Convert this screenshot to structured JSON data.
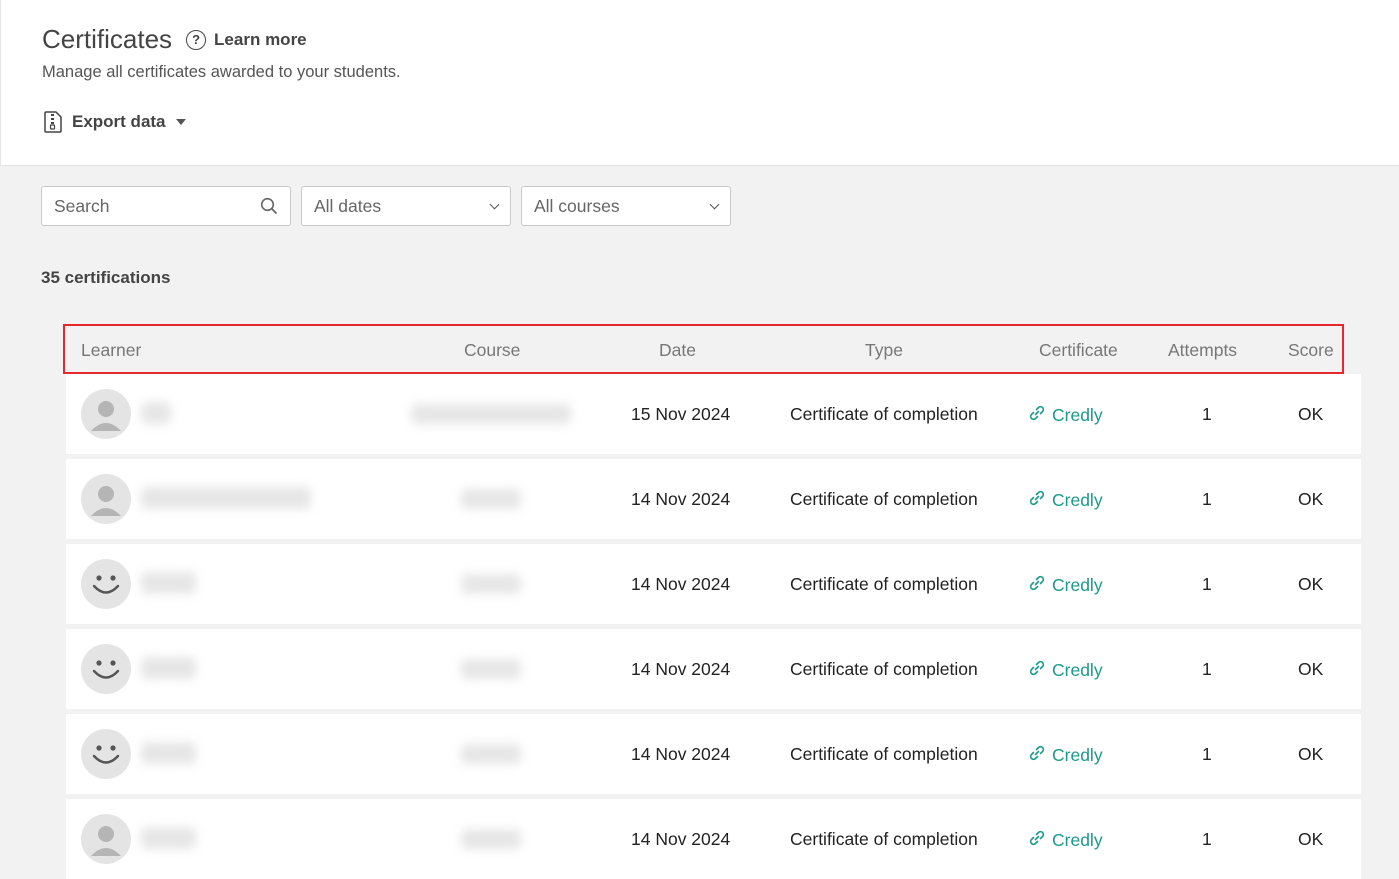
{
  "header": {
    "title": "Certificates",
    "help_label": "Learn more",
    "subtitle": "Manage all certificates awarded to your students.",
    "export_label": "Export data"
  },
  "filters": {
    "search_placeholder": "Search",
    "dates_value": "All dates",
    "courses_value": "All courses"
  },
  "count_label": "35 certifications",
  "columns": {
    "learner": "Learner",
    "course": "Course",
    "date": "Date",
    "type": "Type",
    "certificate": "Certificate",
    "attempts": "Attempts",
    "score": "Score"
  },
  "rows": [
    {
      "avatar": "person-avatar-icon",
      "date": "15 Nov 2024",
      "type": "Certificate of completion",
      "certificate": "Credly",
      "attempts": "1",
      "score": "OK"
    },
    {
      "avatar": "person-avatar-icon",
      "date": "14 Nov 2024",
      "type": "Certificate of completion",
      "certificate": "Credly",
      "attempts": "1",
      "score": "OK"
    },
    {
      "avatar": "smiley-avatar-icon",
      "date": "14 Nov 2024",
      "type": "Certificate of completion",
      "certificate": "Credly",
      "attempts": "1",
      "score": "OK"
    },
    {
      "avatar": "smiley-avatar-icon",
      "date": "14 Nov 2024",
      "type": "Certificate of completion",
      "certificate": "Credly",
      "attempts": "1",
      "score": "OK"
    },
    {
      "avatar": "smiley-avatar-icon",
      "date": "14 Nov 2024",
      "type": "Certificate of completion",
      "certificate": "Credly",
      "attempts": "1",
      "score": "OK"
    },
    {
      "avatar": "person-avatar-icon",
      "date": "14 Nov 2024",
      "type": "Certificate of completion",
      "certificate": "Credly",
      "attempts": "1",
      "score": "OK"
    }
  ],
  "colors": {
    "link": "#1a9a8a",
    "highlight_border": "#e8262d"
  }
}
